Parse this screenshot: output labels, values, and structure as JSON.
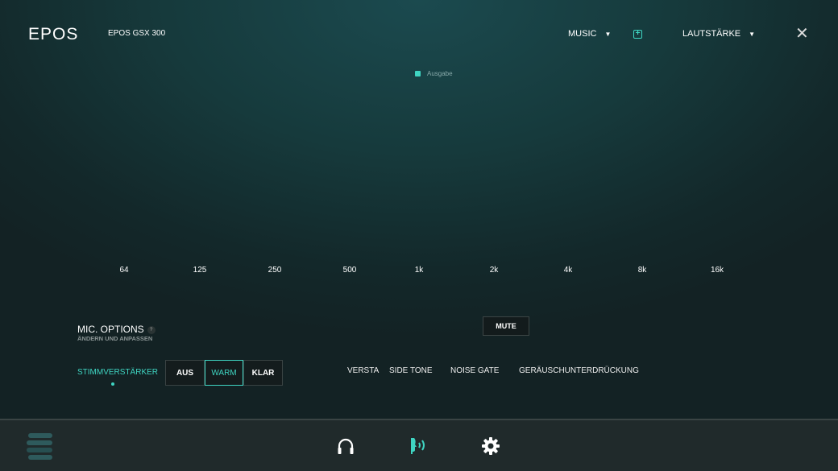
{
  "header": {
    "logo": "EPOS",
    "device": "EPOS GSX 300",
    "preset": "MUSIC",
    "mode": "LAUTSTÄRKE"
  },
  "chart": {
    "legend": "Ausgabe",
    "legend_color": "#3fd5c2",
    "frequencies": [
      "64",
      "125",
      "250",
      "500",
      "1k",
      "2k",
      "4k",
      "8k",
      "16k"
    ]
  },
  "mic": {
    "title": "MIC. OPTIONS",
    "help": "?",
    "subtitle": "ÄNDERN UND ANPASSEN",
    "enhancer_label": "STIMMVERSTÄRKER",
    "options": [
      {
        "label": "AUS",
        "active": false
      },
      {
        "label": "WARM",
        "active": true
      },
      {
        "label": "KLAR",
        "active": false
      }
    ],
    "mute": "MUTE",
    "tabs": [
      "VERSTAR",
      "SIDE TONE",
      "NOISE GATE",
      "GERÄUSCHUNTERDRÜCKUNG"
    ]
  },
  "nav": {
    "icons": [
      "menu-icon",
      "headphones-icon",
      "microphone-voice-icon",
      "settings-icon"
    ],
    "active": "microphone-voice-icon",
    "accent": "#3fd5c2"
  }
}
